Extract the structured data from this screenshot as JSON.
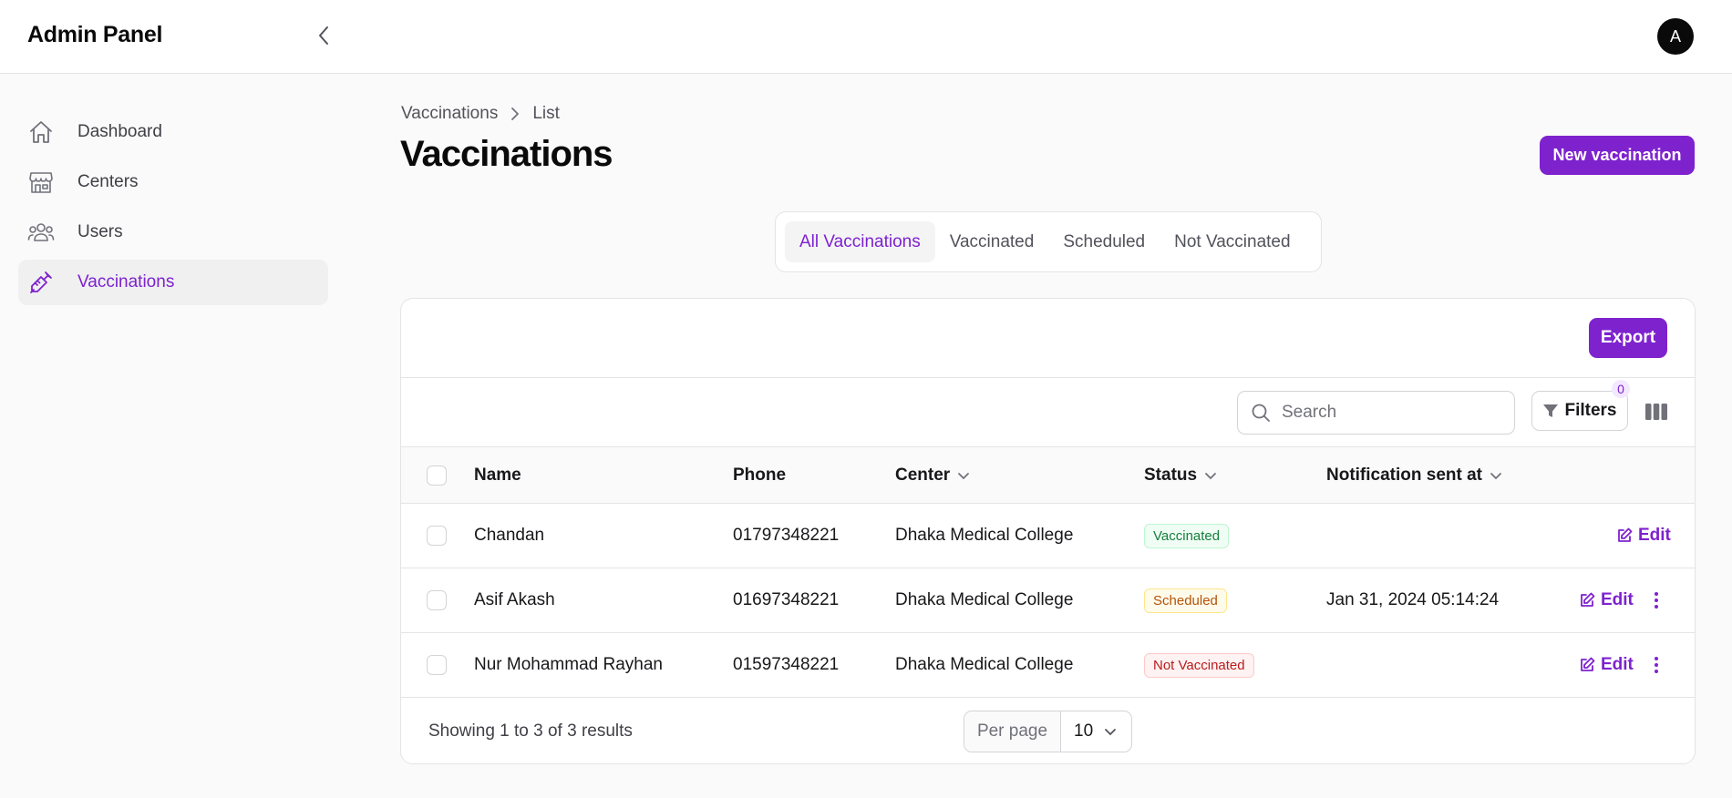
{
  "app": {
    "brand": "Admin Panel",
    "avatar_initial": "A"
  },
  "sidebar": {
    "items": [
      {
        "label": "Dashboard",
        "icon": "home-icon"
      },
      {
        "label": "Centers",
        "icon": "store-icon"
      },
      {
        "label": "Users",
        "icon": "users-icon"
      },
      {
        "label": "Vaccinations",
        "icon": "syringe-icon",
        "active": true
      }
    ]
  },
  "breadcrumb": {
    "items": [
      "Vaccinations",
      "List"
    ]
  },
  "page": {
    "title": "Vaccinations",
    "new_button": "New vaccination"
  },
  "tabs": [
    {
      "label": "All Vaccinations",
      "active": true
    },
    {
      "label": "Vaccinated"
    },
    {
      "label": "Scheduled"
    },
    {
      "label": "Not Vaccinated"
    }
  ],
  "table": {
    "export_label": "Export",
    "search_placeholder": "Search",
    "filters_label": "Filters",
    "filters_count": "0",
    "columns": [
      "Name",
      "Phone",
      "Center",
      "Status",
      "Notification sent at"
    ],
    "rows": [
      {
        "name": "Chandan",
        "phone": "01797348221",
        "center": "Dhaka Medical College",
        "status": "Vaccinated",
        "notified": "",
        "edit": "Edit"
      },
      {
        "name": "Asif Akash",
        "phone": "01697348221",
        "center": "Dhaka Medical College",
        "status": "Scheduled",
        "notified": "Jan 31, 2024 05:14:24",
        "edit": "Edit"
      },
      {
        "name": "Nur Mohammad Rayhan",
        "phone": "01597348221",
        "center": "Dhaka Medical College",
        "status": "Not Vaccinated",
        "notified": "",
        "edit": "Edit"
      }
    ],
    "summary": "Showing 1 to 3 of 3 results",
    "per_page_label": "Per page",
    "per_page_value": "10"
  },
  "colors": {
    "accent": "#7e22ce",
    "success": "#15803d",
    "warning": "#b45309",
    "danger": "#b91c1c"
  }
}
